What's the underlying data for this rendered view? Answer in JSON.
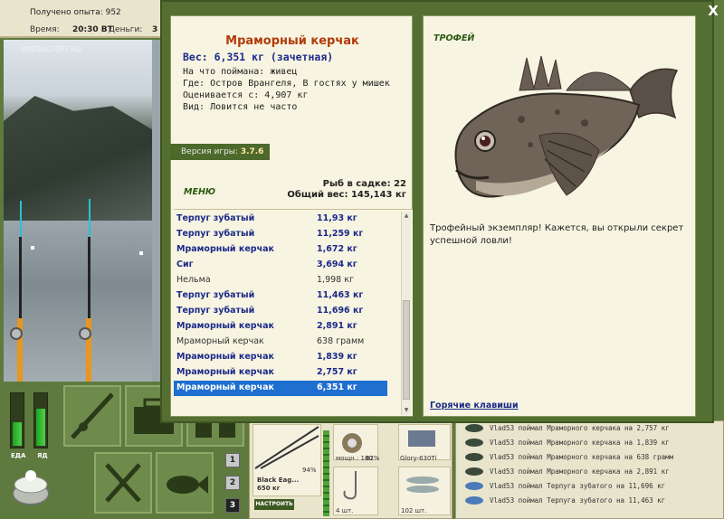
{
  "topbar": {
    "xp_text": "Получено опыта: 952",
    "time_label": "Время:",
    "time_value": "20:30 ВТ",
    "money_label": "Деньги:",
    "money_value": "3"
  },
  "scene": {
    "watermark": "INSTALLSOFT.RU"
  },
  "gauges": {
    "food_label": "ЕДА",
    "poison_label": "ЯД",
    "food_level": 0.45,
    "poison_level": 0.7
  },
  "slots": {
    "n1": "1",
    "n2": "2",
    "n3": "3"
  },
  "inventory": {
    "rod_name": "Black Eag...",
    "rod_weight": "650 кг",
    "rod_durability": "94%",
    "setup_button": "НАСТРОИТЬ",
    "reel_power": "мощн.: 180",
    "reel_durability": "82%",
    "line_name": "Glory-630Ti",
    "hook_count": "4 шт.",
    "bait_count": "102 шт."
  },
  "log": {
    "rows": [
      {
        "text": "Vlad53 поймал Мраморного керчака на 2,757 кг",
        "fish": "dark"
      },
      {
        "text": "Vlad53 поймал Мраморного керчака на 1,839 кг",
        "fish": "dark"
      },
      {
        "text": "Vlad53 поймал Мраморного керчака на 638 грамм",
        "fish": "dark"
      },
      {
        "text": "Vlad53 поймал Мраморного керчака на 2,891 кг",
        "fish": "dark"
      },
      {
        "text": "Vlad53 поймал Терпуга зубатого на 11,696 кг",
        "fish": "blue"
      },
      {
        "text": "Vlad53 поймал Терпуга зубатого на 11,463 кг",
        "fish": "blue"
      }
    ]
  },
  "modal": {
    "close": "X",
    "fish_title": "Мраморный керчак",
    "fish_weight": "Вес: 6,351 кг (зачетная)",
    "caught_on": "На что поймана: живец",
    "where": "Где: Остров Врангеля, В гостях у мишек",
    "value": "Оценивается с: 4,907 кг",
    "kind": "Вид: Ловится не часто",
    "version_label": "Версия игры:",
    "version_value": "3.7.6",
    "menu": "МЕНЮ",
    "keep_count": "Рыб в садке: 22",
    "keep_total": "Общий вес: 145,143 кг",
    "trophy_label": "ТРОФЕЙ",
    "trophy_text": "Трофейный экземпляр! Кажется, вы открыли секрет успешной ловли!",
    "hotkeys": "Горячие клавиши"
  },
  "catch_list": [
    {
      "name": "Терпуг зубатый",
      "weight": "11,93 кг",
      "kind": "trophy"
    },
    {
      "name": "Терпуг зубатый",
      "weight": "11,259 кг",
      "kind": "trophy"
    },
    {
      "name": "Мраморный керчак",
      "weight": "1,672 кг",
      "kind": "trophy"
    },
    {
      "name": "Сиг",
      "weight": "3,694 кг",
      "kind": "trophy"
    },
    {
      "name": "Нельма",
      "weight": "1,998 кг",
      "kind": "normal"
    },
    {
      "name": "Терпуг зубатый",
      "weight": "11,463 кг",
      "kind": "trophy"
    },
    {
      "name": "Терпуг зубатый",
      "weight": "11,696 кг",
      "kind": "trophy"
    },
    {
      "name": "Мраморный керчак",
      "weight": "2,891 кг",
      "kind": "trophy"
    },
    {
      "name": "Мраморный керчак",
      "weight": "638 грамм",
      "kind": "normal"
    },
    {
      "name": "Мраморный керчак",
      "weight": "1,839 кг",
      "kind": "trophy"
    },
    {
      "name": "Мраморный керчак",
      "weight": "2,757 кг",
      "kind": "trophy"
    },
    {
      "name": "Мраморный керчак",
      "weight": "6,351 кг",
      "kind": "sel"
    }
  ],
  "colors": {
    "accent_green": "#556f33",
    "trophy_blue": "#1b2a8a",
    "title_red": "#b33a0a",
    "selection": "#1e6fd0"
  }
}
